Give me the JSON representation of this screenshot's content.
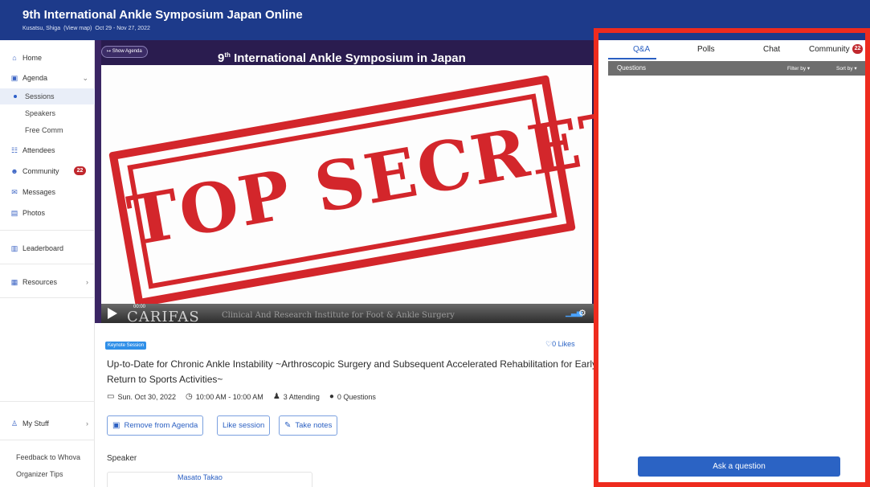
{
  "header": {
    "title": "9th International Ankle Symposium Japan Online",
    "location": "Kusatsu, Shiga",
    "view_map": "(View map)",
    "dates": "Oct 29 - Nov 27, 2022"
  },
  "sidebar": {
    "home": "Home",
    "agenda": "Agenda",
    "sessions": "Sessions",
    "speakers": "Speakers",
    "free_comm": "Free Comm",
    "attendees": "Attendees",
    "community": "Community",
    "community_badge": "22",
    "messages": "Messages",
    "photos": "Photos",
    "leaderboard": "Leaderboard",
    "resources": "Resources",
    "my_stuff": "My Stuff",
    "feedback": "Feedback to Whova",
    "organizer_tips": "Organizer Tips"
  },
  "video": {
    "show_agenda": "Show Agenda",
    "slide_title_num": "9",
    "slide_title_sup": "th",
    "slide_title_rest": " International Ankle Symposium in Japan",
    "stamp_text": "TOP SECRET",
    "time": "00:00",
    "brand": "CARIFAS",
    "institute": "Clinical And Research Institute for Foot & Ankle Surgery"
  },
  "session": {
    "tag": "Keynote Session",
    "likes": "0 Likes",
    "title": "Up-to-Date for Chronic Ankle Instability ~Arthroscopic Surgery and Subsequent Accelerated Rehabilitation for Early Return to Sports Activities~",
    "date": "Sun. Oct 30, 2022",
    "time": "10:00 AM - 10:00 AM",
    "attending": "3 Attending",
    "questions": "0 Questions",
    "btn_remove": "Remove from Agenda",
    "btn_like": "Like session",
    "btn_notes": "Take notes",
    "speaker_label": "Speaker",
    "speaker_name": "Masato Takao"
  },
  "panel": {
    "tab_qa": "Q&A",
    "tab_polls": "Polls",
    "tab_chat": "Chat",
    "tab_community": "Community",
    "tab_community_badge": "22",
    "questions_header": "Questions",
    "filter_by": "Filter by ▾",
    "sort_by": "Sort by ▾",
    "ask_button": "Ask a question"
  },
  "colors": {
    "header_bg": "#1d3a8a",
    "accent_blue": "#2a5fc2",
    "badge_red": "#c0272d",
    "outline_red": "#ee2b1e",
    "stamp_red": "#d3262b"
  }
}
